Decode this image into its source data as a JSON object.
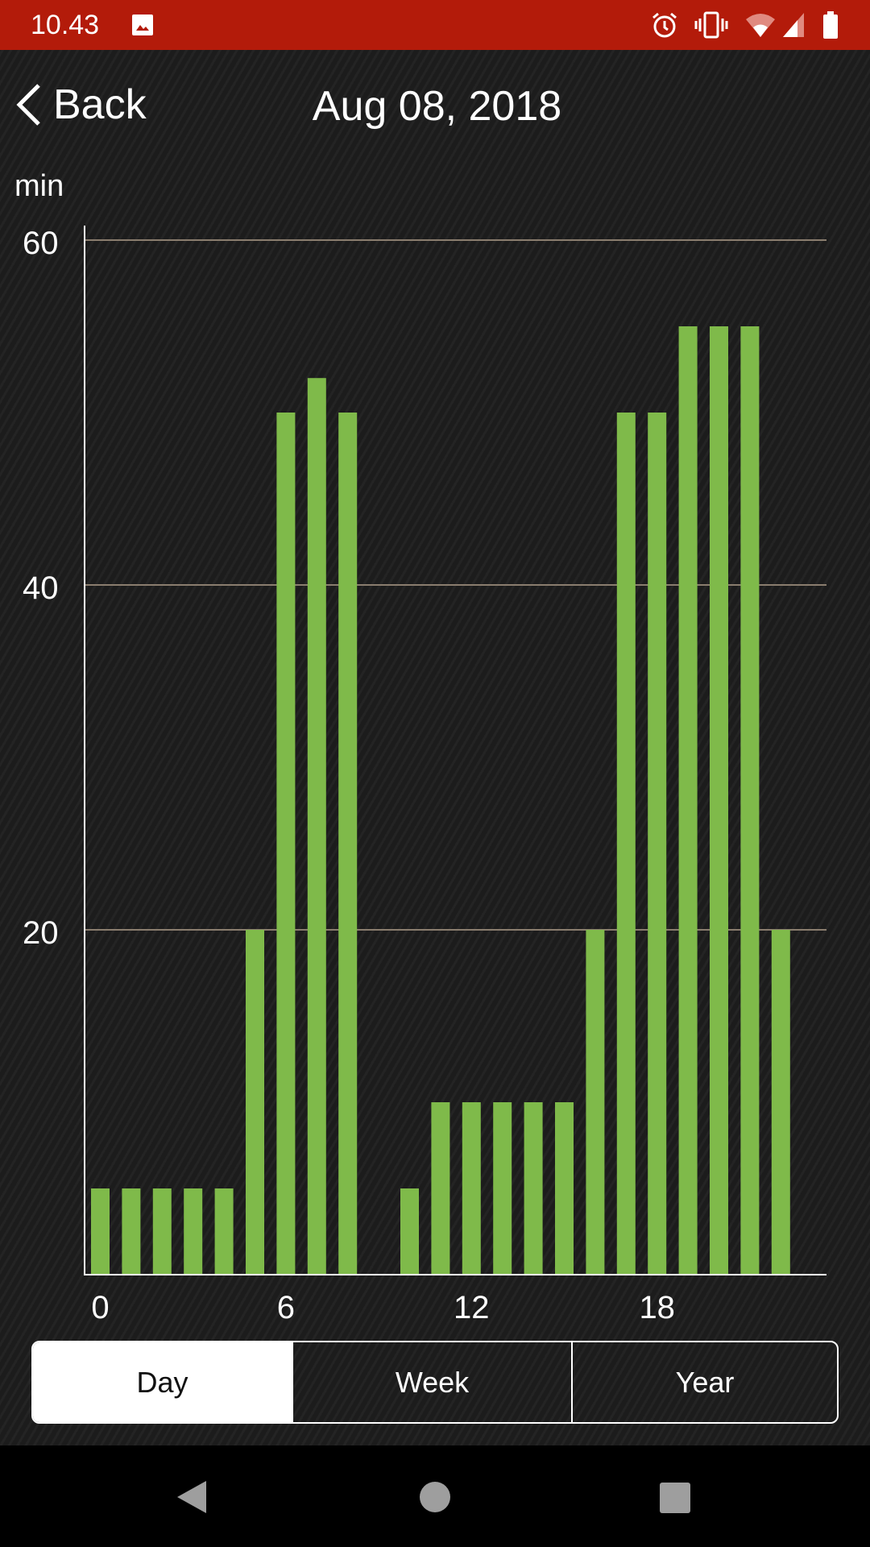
{
  "status_bar": {
    "time": "10.43",
    "icons": [
      "image-icon",
      "alarm-icon",
      "vibrate-icon",
      "wifi-icon",
      "signal-icon",
      "battery-icon"
    ],
    "color": "#b31b0a"
  },
  "header": {
    "back_label": "Back",
    "title": "Aug 08, 2018"
  },
  "chart_data": {
    "type": "bar",
    "ylabel": "min",
    "ylim": [
      0,
      60
    ],
    "yticks": [
      20,
      40,
      60
    ],
    "xticks": [
      0,
      6,
      12,
      18
    ],
    "x": [
      0,
      1,
      2,
      3,
      4,
      5,
      6,
      7,
      8,
      9,
      10,
      11,
      12,
      13,
      14,
      15,
      16,
      17,
      18,
      19,
      20,
      21,
      22,
      23
    ],
    "values": [
      5,
      5,
      5,
      5,
      5,
      20,
      50,
      52,
      50,
      0,
      5,
      10,
      10,
      10,
      10,
      10,
      20,
      50,
      50,
      55,
      55,
      55,
      20,
      0
    ],
    "grid": true,
    "bar_color": "#7fba4a",
    "grid_color": "#8a7d6e"
  },
  "segments": [
    {
      "label": "Day",
      "active": true
    },
    {
      "label": "Week",
      "active": false
    },
    {
      "label": "Year",
      "active": false
    }
  ],
  "nav_bar": {
    "icons": [
      "back-icon",
      "home-icon",
      "recents-icon"
    ]
  }
}
